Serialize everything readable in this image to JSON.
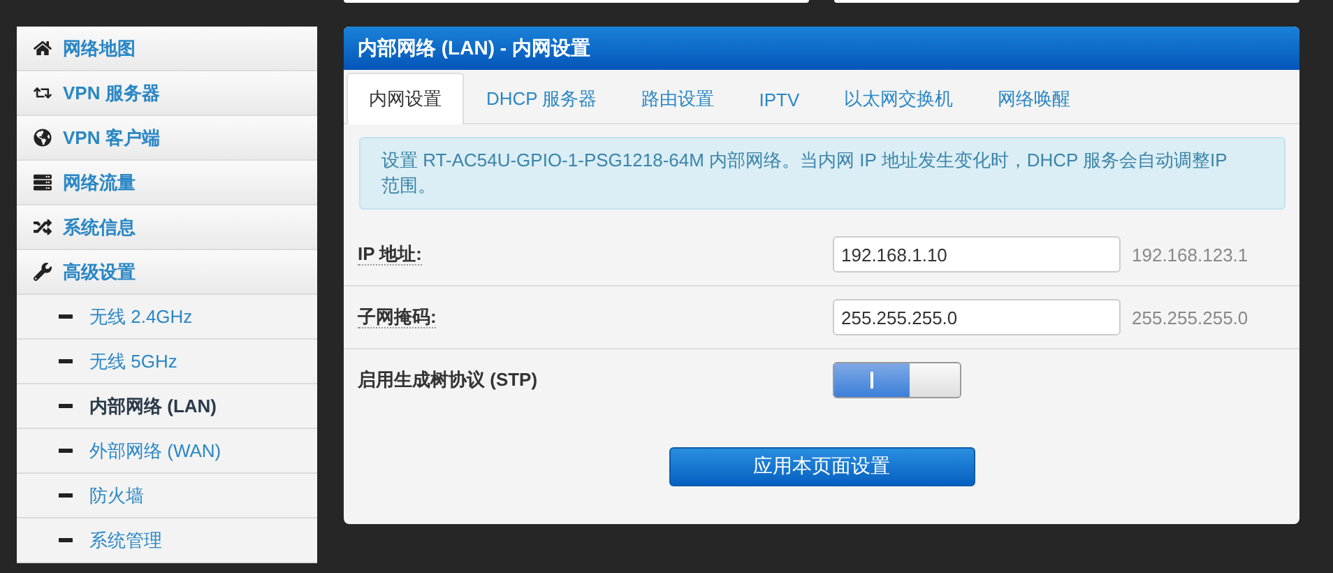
{
  "sidebar": {
    "items": [
      {
        "label": "网络地图",
        "kind": "top",
        "selected": false
      },
      {
        "label": "VPN 服务器",
        "kind": "top",
        "selected": false
      },
      {
        "label": "VPN 客户端",
        "kind": "top",
        "selected": false
      },
      {
        "label": "网络流量",
        "kind": "top",
        "selected": false
      },
      {
        "label": "系统信息",
        "kind": "top",
        "selected": false
      },
      {
        "label": "高级设置",
        "kind": "top",
        "selected": false
      },
      {
        "label": "无线 2.4GHz",
        "kind": "sub",
        "selected": false
      },
      {
        "label": "无线 5GHz",
        "kind": "sub",
        "selected": false
      },
      {
        "label": "内部网络 (LAN)",
        "kind": "sub",
        "selected": true
      },
      {
        "label": "外部网络 (WAN)",
        "kind": "sub",
        "selected": false
      },
      {
        "label": "防火墙",
        "kind": "sub",
        "selected": false
      },
      {
        "label": "系统管理",
        "kind": "sub",
        "selected": false
      }
    ]
  },
  "panel": {
    "title": "内部网络 (LAN) - 内网设置",
    "tabs": [
      {
        "label": "内网设置",
        "selected": true
      },
      {
        "label": "DHCP 服务器",
        "selected": false
      },
      {
        "label": "路由设置",
        "selected": false
      },
      {
        "label": "IPTV",
        "selected": false
      },
      {
        "label": "以太网交换机",
        "selected": false
      },
      {
        "label": "网络唤醒",
        "selected": false
      }
    ],
    "info": "设置 RT-AC54U-GPIO-1-PSG1218-64M 内部网络。当内网 IP 地址发生变化时，DHCP 服务会自动调整IP 范围。",
    "rows": [
      {
        "kind": "input",
        "label": "IP 地址:",
        "value": "192.168.1.10",
        "hint": "192.168.123.1"
      },
      {
        "kind": "input",
        "label": "子网掩码:",
        "value": "255.255.255.0",
        "hint": "255.255.255.0"
      },
      {
        "kind": "toggle",
        "label": "启用生成树协议 (STP)",
        "on": true
      }
    ],
    "apply_button": "应用本页面设置"
  }
}
